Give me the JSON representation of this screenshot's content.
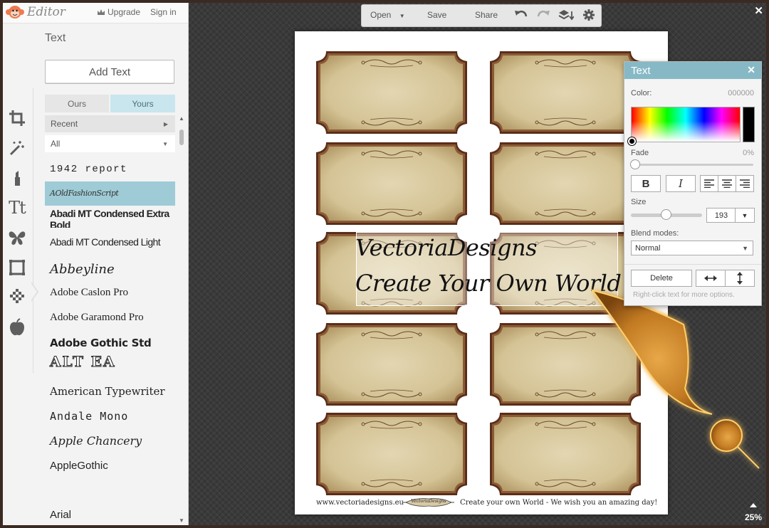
{
  "app": {
    "logo_text": "Editor",
    "upgrade_label": "Upgrade",
    "signin_label": "Sign in",
    "close_glyph": "✕",
    "zoom_level": "25%"
  },
  "toolbar": {
    "open_label": "Open",
    "save_label": "Save",
    "share_label": "Share",
    "icons": [
      "undo-icon",
      "redo-icon",
      "layers-icon",
      "gear-icon"
    ]
  },
  "tool_rail": {
    "items": [
      "crop-icon",
      "magic-wand-icon",
      "touch-up-icon",
      "text-icon",
      "butterfly-icon",
      "frame-icon",
      "texture-icon",
      "apple-icon"
    ],
    "text_tool_glyph": "Tt"
  },
  "text_panel": {
    "title": "Text",
    "add_text_label": "Add Text",
    "tabs": {
      "ours": "Ours",
      "yours": "Yours"
    },
    "recent_label": "Recent",
    "category_value": "All",
    "fonts": [
      {
        "name": "1942 report"
      },
      {
        "name": "AOldFashionScript"
      },
      {
        "name": "Abadi MT Condensed Extra Bold"
      },
      {
        "name": "Abadi MT Condensed Light"
      },
      {
        "name": "Abbeyline"
      },
      {
        "name": "Adobe Caslon Pro"
      },
      {
        "name": "Adobe Garamond Pro"
      },
      {
        "name": "Adobe Gothic Std"
      },
      {
        "name": "ALT EA"
      },
      {
        "name": "American Typewriter"
      },
      {
        "name": "Andale Mono"
      },
      {
        "name": "Apple Chancery"
      },
      {
        "name": "AppleGothic"
      },
      {
        "name": "Arial"
      }
    ]
  },
  "canvas": {
    "text_line1": "VectoriaDesigns",
    "text_line2": "Create Your Own World",
    "footer_site": "www.vectoriadesigns.eu",
    "footer_logo": "VectoriaDesigns",
    "footer_tagline": "Create your own World - We wish you an amazing day!",
    "accent_colors": {
      "label_border": "#6b3a22",
      "parchment": "#d9c9a0"
    }
  },
  "text_props": {
    "title": "Text",
    "close_glyph": "✕",
    "color_label": "Color:",
    "color_value": "000000",
    "fade_label": "Fade",
    "fade_value": "0%",
    "bold_label": "B",
    "italic_label": "I",
    "align_icons": [
      "align-left-icon",
      "align-center-icon",
      "align-right-icon"
    ],
    "size_label": "Size",
    "size_value": "193",
    "blend_label": "Blend modes:",
    "blend_value": "Normal",
    "delete_label": "Delete",
    "hint": "Right-click text for more options."
  }
}
